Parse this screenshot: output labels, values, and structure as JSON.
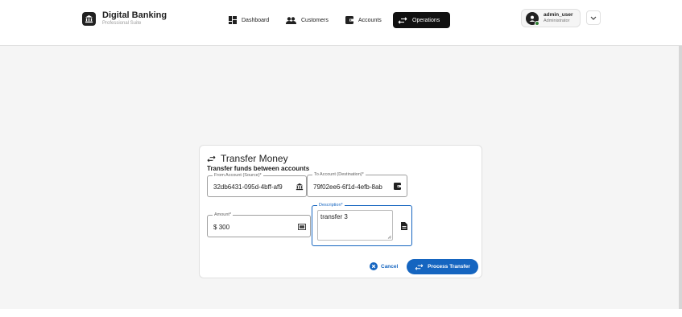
{
  "brand": {
    "title": "Digital Banking",
    "subtitle": "Professional Suite",
    "logo_icon": "bank-icon"
  },
  "nav": {
    "items": [
      {
        "label": "Dashboard",
        "icon": "dashboard-grid-icon",
        "active": false
      },
      {
        "label": "Customers",
        "icon": "people-icon",
        "active": false
      },
      {
        "label": "Accounts",
        "icon": "wallet-icon",
        "active": false
      },
      {
        "label": "Operations",
        "icon": "swap-arrows-icon",
        "active": true
      }
    ]
  },
  "user": {
    "name": "admin_user",
    "role": "Administrator",
    "status_color": "#2e7d32"
  },
  "form": {
    "title": "Transfer Money",
    "subtitle": "Transfer funds between accounts",
    "from": {
      "label": "From Account (Source)*",
      "value": "32db6431-095d-4bff-af9",
      "icon": "bank-icon"
    },
    "to": {
      "label": "To Account (Destination)*",
      "value": "79f02ee6-6f1d-4efb-8ab",
      "icon": "wallet-icon"
    },
    "amount": {
      "label": "Amount*",
      "prefix": "$",
      "value": "300",
      "icon": "cash-icon"
    },
    "description": {
      "label": "Description*",
      "value": "transfer 3",
      "icon": "document-icon"
    },
    "cancel_label": "Cancel",
    "submit_label": "Process Transfer"
  },
  "colors": {
    "primary": "#1565c0",
    "nav_active": "#111111",
    "background": "#f5f5f5"
  }
}
